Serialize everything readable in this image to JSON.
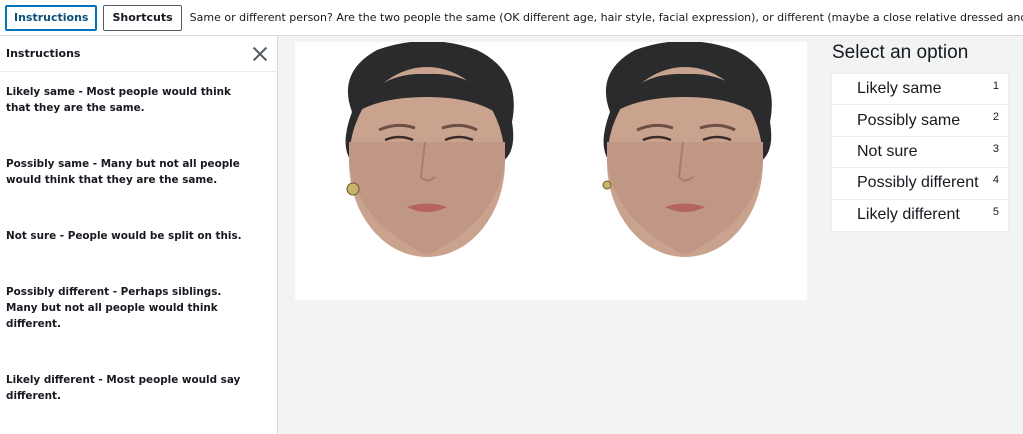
{
  "toolbar": {
    "instructions_label": "Instructions",
    "shortcuts_label": "Shortcuts",
    "task_text": "Same or different person? Are the two people the same (OK different age, hair style, facial expression), or different (maybe a close relative dressed and sty"
  },
  "sidebar": {
    "title": "Instructions",
    "items": [
      "Likely same - Most people would think that they are the same.",
      "Possibly same - Many but not all people would think that they are the same.",
      "Not sure - People would be split on this.",
      "Possibly different - Perhaps siblings. Many but not all people would think different.",
      "Likely different - Most people would say different."
    ]
  },
  "options": {
    "title": "Select an option",
    "items": [
      {
        "label": "Likely same",
        "key": "1"
      },
      {
        "label": "Possibly same",
        "key": "2"
      },
      {
        "label": "Not sure",
        "key": "3"
      },
      {
        "label": "Possibly different",
        "key": "4"
      },
      {
        "label": "Likely different",
        "key": "5"
      }
    ]
  },
  "colors": {
    "accent": "#0073bb",
    "background": "#f2f3f3",
    "skin": "#c9a38e",
    "hair": "#2b2b2e"
  }
}
